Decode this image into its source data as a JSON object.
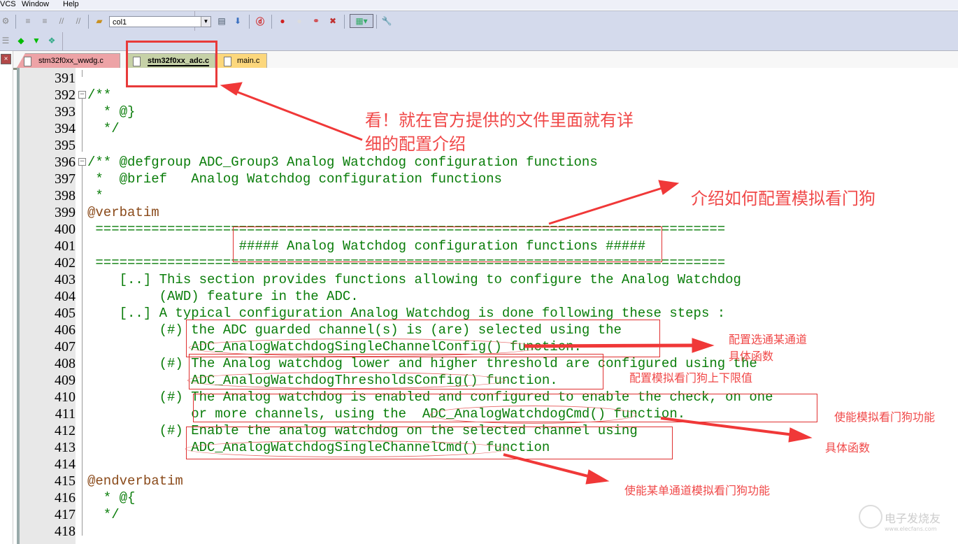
{
  "menubar": {
    "items": [
      "VCS",
      "Window",
      "Help"
    ]
  },
  "toolbar": {
    "combo_value": "col1",
    "icons": [
      "outline-icon",
      "indent-icon",
      "unindent-icon",
      "comment-icon",
      "uncomment-icon",
      "open-folder-icon",
      "find-in-files-icon",
      "find-icon",
      "debug-icon",
      "breakpoint-icon",
      "breakpoint-disabled-icon",
      "breakpoints-icon",
      "kill-breakpoints-icon",
      "window-icon",
      "wrench-icon"
    ]
  },
  "toolbar2": {
    "icons": [
      "tree-icon",
      "green-diamond-icon",
      "filter-icon",
      "multi-diamond-icon"
    ]
  },
  "tabs": [
    {
      "label": "stm32f0xx_wwdg.c",
      "color": "#eda3a6",
      "active": false
    },
    {
      "label": "stm32f0xx_adc.c",
      "color": "#c6d1a7",
      "active": true
    },
    {
      "label": "main.c",
      "color": "#fcd77c",
      "active": false
    }
  ],
  "lines": [
    {
      "n": "391",
      "code": ""
    },
    {
      "n": "392",
      "code": "/**"
    },
    {
      "n": "393",
      "code": "  * @}"
    },
    {
      "n": "394",
      "code": "  */"
    },
    {
      "n": "395",
      "code": ""
    },
    {
      "n": "396",
      "code": "/** @defgroup ADC_Group3 Analog Watchdog configuration functions"
    },
    {
      "n": "397",
      "code": " *  @brief   Analog Watchdog configuration functions"
    },
    {
      "n": "398",
      "code": " *"
    },
    {
      "n": "399",
      "code": "@verbatim"
    },
    {
      "n": "400",
      "code": " ==============================================================================="
    },
    {
      "n": "401",
      "code": "                   ##### Analog Watchdog configuration functions #####"
    },
    {
      "n": "402",
      "code": " ==============================================================================="
    },
    {
      "n": "403",
      "code": "    [..] This section provides functions allowing to configure the Analog Watchdog"
    },
    {
      "n": "404",
      "code": "         (AWD) feature in the ADC."
    },
    {
      "n": "405",
      "code": "    [..] A typical configuration Analog Watchdog is done following these steps :"
    },
    {
      "n": "406",
      "code": "         (#) the ADC guarded channel(s) is (are) selected using the"
    },
    {
      "n": "407",
      "code": "             ADC_AnalogWatchdogSingleChannelConfig() function."
    },
    {
      "n": "408",
      "code": "         (#) The Analog watchdog lower and higher threshold are configured using the"
    },
    {
      "n": "409",
      "code": "             ADC_AnalogWatchdogThresholdsConfig() function."
    },
    {
      "n": "410",
      "code": "         (#) The Analog watchdog is enabled and configured to enable the check, on one"
    },
    {
      "n": "411",
      "code": "             or more channels, using the  ADC_AnalogWatchdogCmd() function."
    },
    {
      "n": "412",
      "code": "         (#) Enable the analog watchdog on the selected channel using"
    },
    {
      "n": "413",
      "code": "             ADC_AnalogWatchdogSingleChannelCmd() function"
    },
    {
      "n": "414",
      "code": ""
    },
    {
      "n": "415",
      "code": "@endverbatim"
    },
    {
      "n": "416",
      "code": "  * @{"
    },
    {
      "n": "417",
      "code": "  */"
    },
    {
      "n": "418",
      "code": ""
    }
  ],
  "annotations": {
    "look": "看！就在官方提供的文件里面就有详",
    "look2": "细的配置介绍",
    "intro": "介绍如何配置模拟看门狗",
    "select_channel": "配置选通某通道",
    "specific_func": "具体函数",
    "thresholds": "配置模拟看门狗上下限值",
    "enable_awd": "使能模拟看门狗功能",
    "specific_func2": "具体函数",
    "enable_single": "使能某单通道模拟看门狗功能"
  },
  "watermark": {
    "name": "电子发烧友",
    "url": "www.elecfans.com"
  },
  "colors": {
    "comment": "#0a7d0a",
    "tag": "#8a4a1a",
    "annotation": "#f04848"
  }
}
